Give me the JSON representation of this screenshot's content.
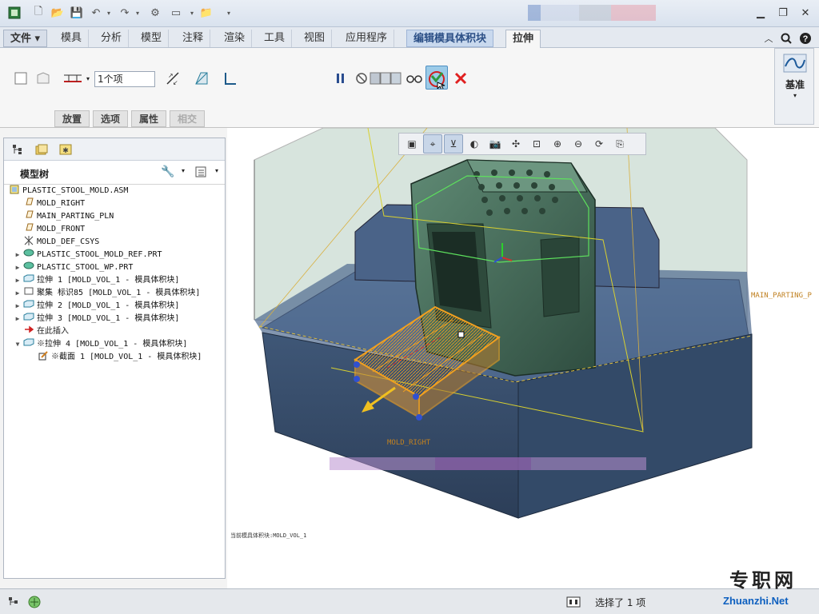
{
  "colors": {
    "accent": "#2b4f86",
    "selection_orange": "#f0a020",
    "mold_block": "#5f7fa6",
    "cancel_red": "#e02020",
    "confirm_green": "#2e9a3c"
  },
  "tabs": {
    "file": "文件",
    "items": [
      "模具",
      "分析",
      "模型",
      "注释",
      "渲染",
      "工具",
      "视图",
      "应用程序"
    ],
    "context": "编辑模具体积块",
    "active": "拉伸"
  },
  "ribbon": {
    "depth_value": "1个项",
    "datum_label": "基准",
    "subtabs": [
      "放置",
      "选项",
      "属性",
      "相交"
    ]
  },
  "model_tree": {
    "title": "模型树",
    "rows": [
      {
        "label": "PLASTIC_STOOL_MOLD.ASM",
        "icon": "assembly-icon",
        "expand": ""
      },
      {
        "label": "MOLD_RIGHT",
        "icon": "datum-plane-icon",
        "expand": ""
      },
      {
        "label": "MAIN_PARTING_PLN",
        "icon": "datum-plane-icon",
        "expand": ""
      },
      {
        "label": "MOLD_FRONT",
        "icon": "datum-plane-icon",
        "expand": ""
      },
      {
        "label": "MOLD_DEF_CSYS",
        "icon": "csys-icon",
        "expand": ""
      },
      {
        "label": "PLASTIC_STOOL_MOLD_REF.PRT",
        "icon": "part-icon",
        "expand": "▶"
      },
      {
        "label": "PLASTIC_STOOL_WP.PRT",
        "icon": "part-icon",
        "expand": "▶"
      },
      {
        "label": "拉伸 1 [MOLD_VOL_1 - 模具体积块]",
        "icon": "extrude-icon",
        "expand": "▶"
      },
      {
        "label": "聚集 标识85 [MOLD_VOL_1 - 模具体积块]",
        "icon": "gather-icon",
        "expand": "▶"
      },
      {
        "label": "拉伸 2 [MOLD_VOL_1 - 模具体积块]",
        "icon": "extrude-icon",
        "expand": "▶"
      },
      {
        "label": "拉伸 3 [MOLD_VOL_1 - 模具体积块]",
        "icon": "extrude-icon",
        "expand": "▶"
      },
      {
        "label": "在此插入",
        "icon": "insert-arrow-icon",
        "expand": ""
      },
      {
        "label": "※拉伸 4 [MOLD_VOL_1 - 模具体积块]",
        "icon": "extrude-icon",
        "expand": "▼"
      },
      {
        "label": "※截面 1 [MOLD_VOL_1 - 模具体积块]",
        "icon": "sketch-icon",
        "expand": ""
      }
    ]
  },
  "viewport": {
    "parting_label": "MAIN_PARTING_P",
    "right_label": "MOLD_RIGHT",
    "note": "当前模具体积块:MOLD_VOL_1"
  },
  "status": {
    "text": "选择了 1 项"
  },
  "watermark": {
    "cn": "专职网",
    "en": "Zhuanzhi.Net"
  }
}
